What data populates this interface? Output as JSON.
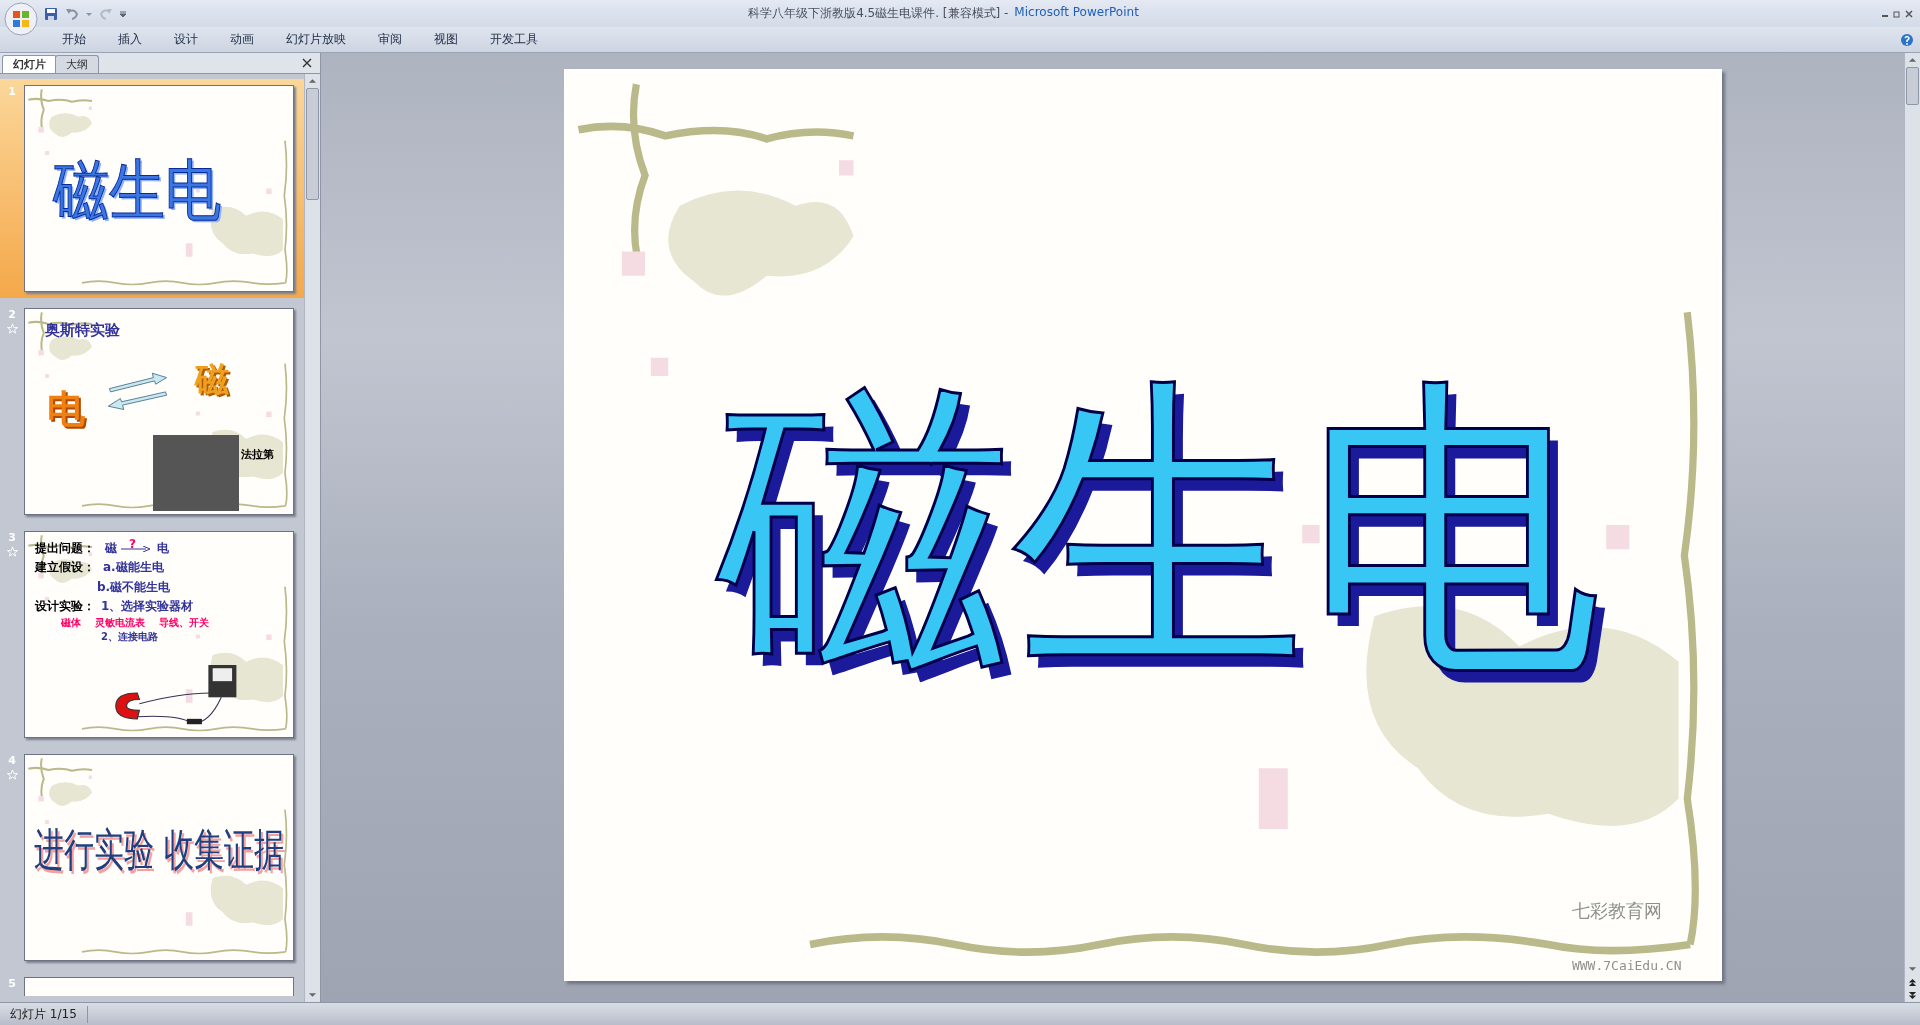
{
  "window": {
    "document_title": "科学八年级下浙教版4.5磁生电课件. [兼容模式] -",
    "app_name": "Microsoft PowerPoint"
  },
  "ribbon_tabs": [
    "开始",
    "插入",
    "设计",
    "动画",
    "幻灯片放映",
    "审阅",
    "视图",
    "开发工具"
  ],
  "panel_tabs": [
    {
      "label": "幻灯片",
      "selected": true
    },
    {
      "label": "大纲",
      "selected": false
    }
  ],
  "thumbnails": [
    {
      "number": "1",
      "selected": true,
      "animated": false,
      "kind": "wordart",
      "title": "磁生电"
    },
    {
      "number": "2",
      "selected": false,
      "animated": true,
      "kind": "oersted",
      "title": "奥斯特实验",
      "left_word": "电",
      "right_word": "磁",
      "caption": "法拉第"
    },
    {
      "number": "3",
      "selected": false,
      "animated": true,
      "kind": "lines",
      "question_label": "提出问题：",
      "question_from": "磁",
      "question_mark": "?",
      "question_to": "电",
      "hypothesis_label": "建立假设：",
      "hypotheses": [
        "a.磁能生电",
        "b.磁不能生电"
      ],
      "design_label": "设计实验：",
      "steps": [
        "1、选择实验器材",
        "2、连接电路"
      ],
      "materials": [
        "磁体",
        "灵敏电流表",
        "导线、开关"
      ]
    },
    {
      "number": "4",
      "selected": false,
      "animated": true,
      "kind": "banner",
      "title": "进行实验 收集证据"
    },
    {
      "number": "5",
      "selected": false,
      "animated": false,
      "kind": "partial"
    }
  ],
  "slide": {
    "title": "磁生电",
    "brand": "七彩教育网",
    "url": "WWW.7CaiEdu.CN"
  },
  "status_bar": {
    "slide_counter": "幻灯片 1/15"
  }
}
